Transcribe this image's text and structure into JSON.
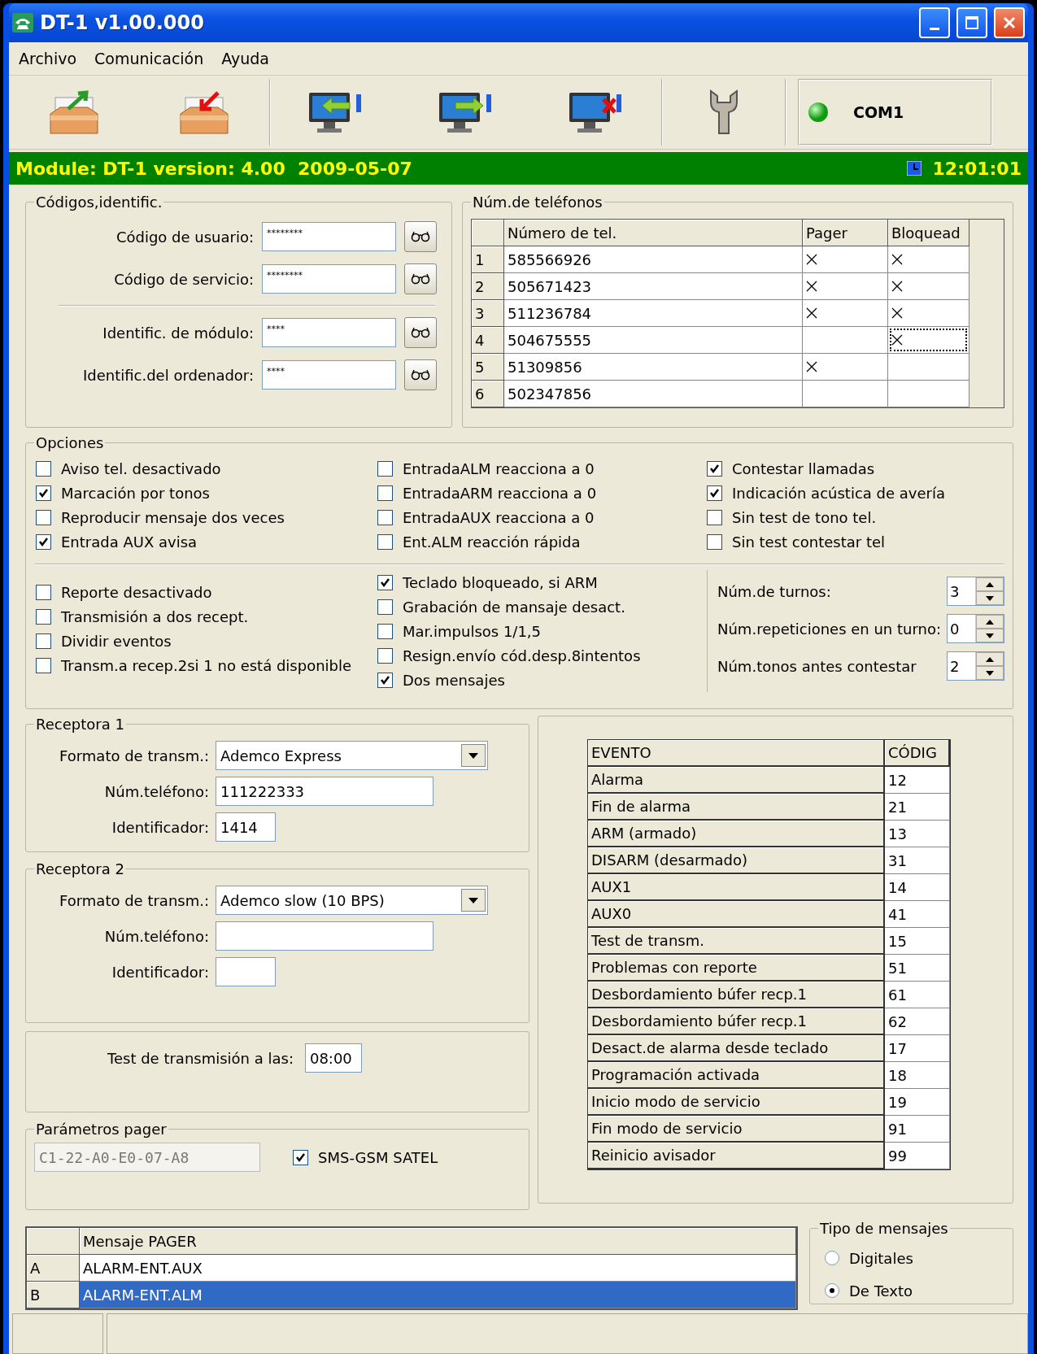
{
  "window": {
    "title": "DT-1 v1.00.000"
  },
  "menu": [
    {
      "label": "Archivo"
    },
    {
      "label": "Comunicación"
    },
    {
      "label": "Ayuda"
    }
  ],
  "toolbar": {
    "groups": [
      [
        {
          "kind": "tray-export"
        },
        {
          "kind": "tray-import"
        }
      ],
      [
        {
          "kind": "monitor-read"
        },
        {
          "kind": "monitor-write"
        },
        {
          "kind": "monitor-cancel"
        }
      ],
      [
        {
          "kind": "wrench"
        }
      ]
    ],
    "port": {
      "label": "COM1",
      "connected": true
    }
  },
  "module_bar": {
    "text": "Module: DT-1 version: 4.00  2009-05-07",
    "time": "12:01:01"
  },
  "codes": {
    "title": "Códigos,identific.",
    "codes": [
      {
        "label": "Código de usuario:",
        "value": "********"
      },
      {
        "label": "Código de servicio:",
        "value": "********"
      }
    ],
    "identifiers": [
      {
        "label": "Identific. de módulo:",
        "value": "****"
      },
      {
        "label": "Identific.del ordenador:",
        "value": "****"
      }
    ]
  },
  "phones": {
    "title": "Núm.de teléfonos",
    "columns": [
      "Número de tel.",
      "Pager",
      "Bloquead"
    ],
    "rows": [
      {
        "index": "1",
        "number": "585566926",
        "pager": true,
        "blocked": true,
        "focused": false
      },
      {
        "index": "2",
        "number": "505671423",
        "pager": true,
        "blocked": true,
        "focused": false
      },
      {
        "index": "3",
        "number": "511236784",
        "pager": true,
        "blocked": true,
        "focused": false
      },
      {
        "index": "4",
        "number": "504675555",
        "pager": false,
        "blocked": true,
        "focused": true
      },
      {
        "index": "5",
        "number": "51309856",
        "pager": true,
        "blocked": false,
        "focused": false
      },
      {
        "index": "6",
        "number": "502347856",
        "pager": false,
        "blocked": false,
        "focused": false
      }
    ]
  },
  "options": {
    "title": "Opciones",
    "top_columns": [
      [
        {
          "label": "Aviso tel. desactivado",
          "checked": false
        },
        {
          "label": "Marcación por tonos",
          "checked": true
        },
        {
          "label": "Reproducir mensaje dos veces",
          "checked": false
        },
        {
          "label": "Entrada AUX avisa",
          "checked": true
        }
      ],
      [
        {
          "label": "EntradaALM reacciona a 0",
          "checked": false
        },
        {
          "label": "EntradaARM reacciona a 0",
          "checked": false
        },
        {
          "label": "EntradaAUX reacciona a 0",
          "checked": false
        },
        {
          "label": "Ent.ALM reacción rápida",
          "checked": false
        }
      ],
      [
        {
          "label": "Contestar llamadas",
          "checked": true
        },
        {
          "label": "Indicación acústica de avería",
          "checked": true
        },
        {
          "label": "Sin test de tono tel.",
          "checked": false
        },
        {
          "label": "Sin test contestar tel",
          "checked": false
        }
      ]
    ],
    "bottom_columns": [
      [
        {
          "label": "Reporte desactivado",
          "checked": false
        },
        {
          "label": "Transmisión a dos recept.",
          "checked": false
        },
        {
          "label": "Dividir eventos",
          "checked": false
        },
        {
          "label": "Transm.a recep.2si 1 no está disponible",
          "checked": false
        }
      ],
      [
        {
          "label": "Teclado bloqueado, si ARM",
          "checked": true
        },
        {
          "label": "Grabación de mansaje desact.",
          "checked": false
        },
        {
          "label": "Mar.impulsos 1/1,5",
          "checked": false
        },
        {
          "label": "Resign.envío cód.desp.8intentos",
          "checked": false
        },
        {
          "label": "Dos mensajes",
          "checked": true
        }
      ]
    ],
    "spinners": [
      {
        "label": "Núm.de turnos:",
        "value": "3"
      },
      {
        "label": "Núm.repeticiones en un turno:",
        "value": "0"
      },
      {
        "label": "Núm.tonos antes contestar",
        "value": "2"
      }
    ]
  },
  "receivers": [
    {
      "title": "Receptora 1",
      "format_label": "Formato de transm.:",
      "format": "Ademco Express",
      "phone_label": "Núm.teléfono:",
      "phone": "111222333",
      "id_label": "Identificador:",
      "id": "1414"
    },
    {
      "title": "Receptora 2",
      "format_label": "Formato de transm.:",
      "format": "Ademco slow (10 BPS)",
      "phone_label": "Núm.teléfono:",
      "id_label": "Identificador:"
    }
  ],
  "test": {
    "label": "Test de transmisión a las:",
    "value": "08:00"
  },
  "pager": {
    "title": "Parámetros pager",
    "code": "C1-22-A0-E0-07-A8",
    "sms": {
      "label": "SMS-GSM SATEL",
      "checked": true
    }
  },
  "events": {
    "columns": [
      "EVENTO",
      "CÓDIG"
    ],
    "rows": [
      {
        "event": "Alarma",
        "code": "12"
      },
      {
        "event": "Fin de alarma",
        "code": "21"
      },
      {
        "event": "ARM (armado)",
        "code": "13"
      },
      {
        "event": "DISARM (desarmado)",
        "code": "31"
      },
      {
        "event": "AUX1",
        "code": "14"
      },
      {
        "event": "AUX0",
        "code": "41"
      },
      {
        "event": "Test de transm.",
        "code": "15"
      },
      {
        "event": "Problemas con reporte",
        "code": "51"
      },
      {
        "event": "Desbordamiento búfer recp.1",
        "code": "61"
      },
      {
        "event": "Desbordamiento búfer recp.1",
        "code": "62"
      },
      {
        "event": "Desact.de alarma desde teclado",
        "code": "17"
      },
      {
        "event": "Programación activada",
        "code": "18"
      },
      {
        "event": "Inicio modo de servicio",
        "code": "19"
      },
      {
        "event": "Fin modo de servicio",
        "code": "91"
      },
      {
        "event": "Reinicio avisador",
        "code": "99"
      }
    ]
  },
  "messages": {
    "column": "Mensaje PAGER",
    "rows": [
      {
        "index": "A",
        "text": "ALARM-ENT.AUX",
        "selected": false
      },
      {
        "index": "B",
        "text": "ALARM-ENT.ALM",
        "selected": true
      }
    ]
  },
  "message_type": {
    "title": "Tipo de mensajes",
    "options": [
      {
        "label": "Digitales",
        "selected": false
      },
      {
        "label": "De Texto",
        "selected": true
      }
    ]
  }
}
